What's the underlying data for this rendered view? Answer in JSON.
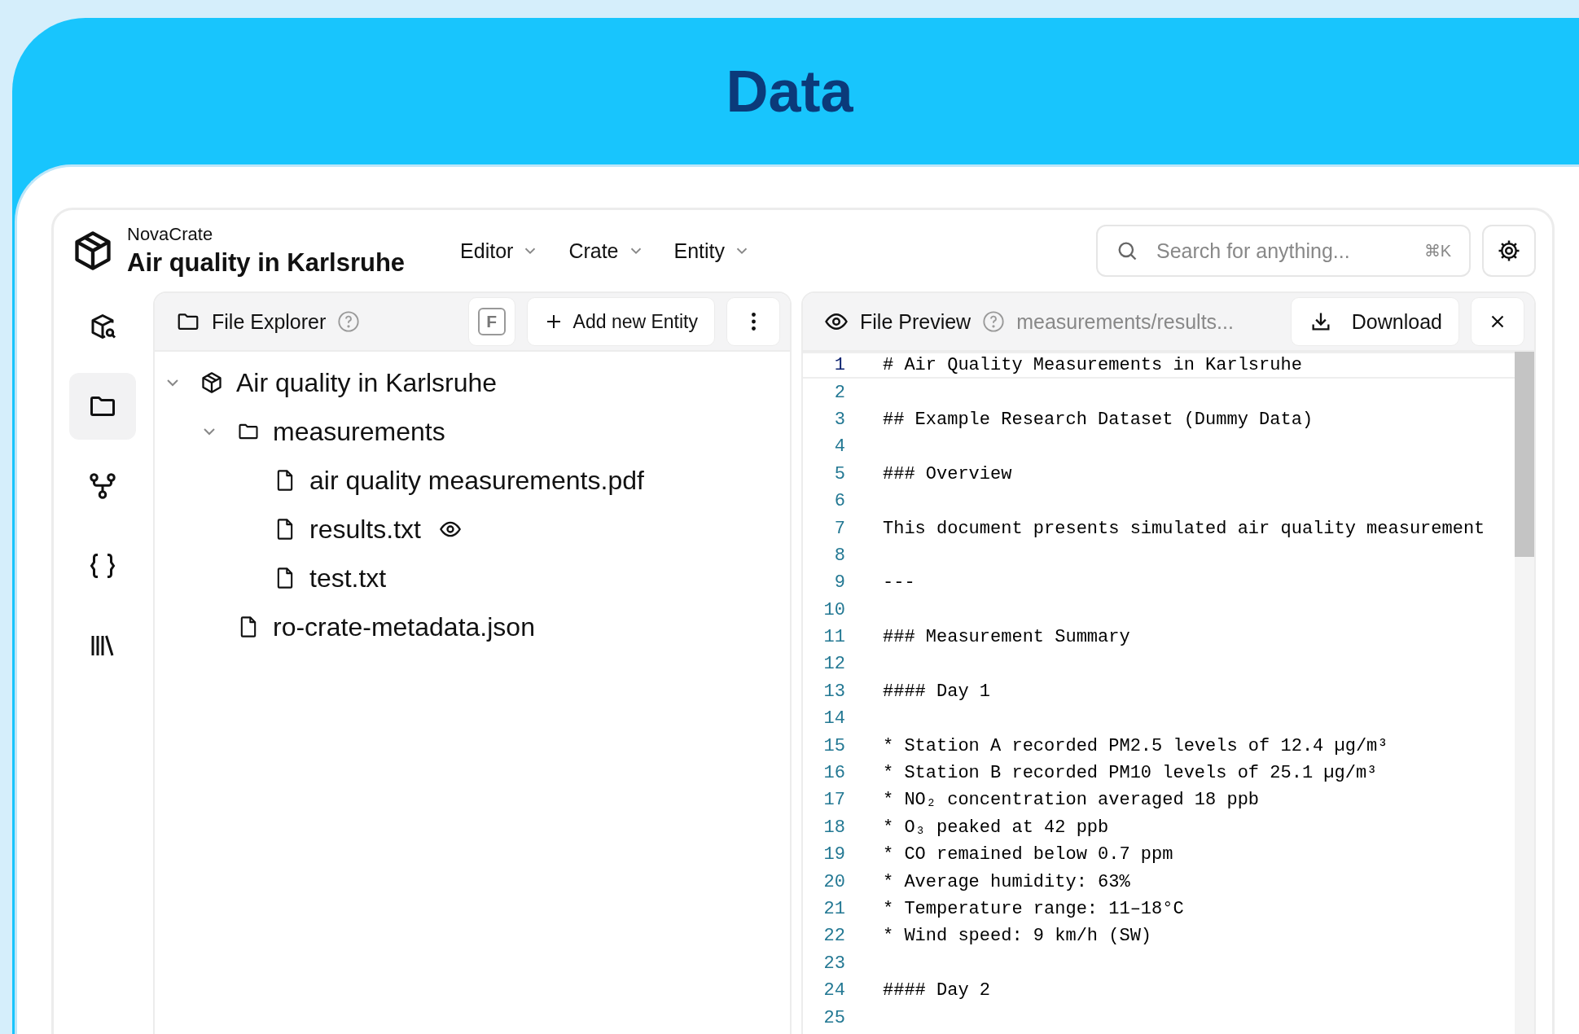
{
  "page_title": "Data",
  "app": {
    "brand": "NovaCrate",
    "project": "Air quality in Karlsruhe"
  },
  "menus": [
    {
      "label": "Editor"
    },
    {
      "label": "Crate"
    },
    {
      "label": "Entity"
    }
  ],
  "search": {
    "placeholder": "Search for anything...",
    "shortcut": "⌘K"
  },
  "sidebar": {
    "items": [
      {
        "kind": "crate-search",
        "selected": false
      },
      {
        "kind": "folder",
        "selected": true
      },
      {
        "kind": "graph",
        "selected": false
      },
      {
        "kind": "json",
        "selected": false
      },
      {
        "kind": "library",
        "selected": false
      }
    ]
  },
  "file_explorer": {
    "title": "File Explorer",
    "shortcut_key": "F",
    "add_button": "Add new Entity",
    "tree": [
      {
        "kind": "crate",
        "name": "Air quality in Karlsruhe",
        "expanded": true,
        "children": [
          {
            "kind": "folder",
            "name": "measurements",
            "expanded": true,
            "children": [
              {
                "kind": "file",
                "name": "air quality measurements.pdf",
                "previewed": false
              },
              {
                "kind": "file",
                "name": "results.txt",
                "previewed": true
              },
              {
                "kind": "file",
                "name": "test.txt",
                "previewed": false
              }
            ]
          },
          {
            "kind": "file",
            "name": "ro-crate-metadata.json",
            "previewed": false
          }
        ]
      }
    ]
  },
  "file_preview": {
    "title": "File Preview",
    "path": "measurements/results...",
    "download_button": "Download",
    "lines": [
      {
        "number": "1",
        "text": "# Air Quality Measurements in Karlsruhe",
        "selected": true
      },
      {
        "number": "2",
        "selected": false
      },
      {
        "number": "3",
        "text": "## Example Research Dataset (Dummy Data)",
        "selected": false
      },
      {
        "number": "4",
        "selected": false
      },
      {
        "number": "5",
        "text": "### Overview",
        "selected": false
      },
      {
        "number": "6",
        "selected": false
      },
      {
        "number": "7",
        "text": "This document presents simulated air quality measurement",
        "selected": false
      },
      {
        "number": "8",
        "selected": false
      },
      {
        "number": "9",
        "text": "---",
        "selected": false
      },
      {
        "number": "10",
        "selected": false
      },
      {
        "number": "11",
        "text": "### Measurement Summary",
        "selected": false
      },
      {
        "number": "12",
        "selected": false
      },
      {
        "number": "13",
        "text": "#### Day 1",
        "selected": false
      },
      {
        "number": "14",
        "selected": false
      },
      {
        "number": "15",
        "text": "* Station A recorded PM2.5 levels of 12.4 µg/m³",
        "selected": false
      },
      {
        "number": "16",
        "text": "* Station B recorded PM10 levels of 25.1 µg/m³",
        "selected": false
      },
      {
        "number": "17",
        "text": "* NO₂ concentration averaged 18 ppb",
        "selected": false
      },
      {
        "number": "18",
        "text": "* O₃ peaked at 42 ppb",
        "selected": false
      },
      {
        "number": "19",
        "text": "* CO remained below 0.7 ppm",
        "selected": false
      },
      {
        "number": "20",
        "text": "* Average humidity: 63%",
        "selected": false
      },
      {
        "number": "21",
        "text": "* Temperature range: 11–18°C",
        "selected": false
      },
      {
        "number": "22",
        "text": "* Wind speed: 9 km/h (SW)",
        "selected": false
      },
      {
        "number": "23",
        "selected": false
      },
      {
        "number": "24",
        "text": "#### Day 2",
        "selected": false
      },
      {
        "number": "25",
        "selected": false
      }
    ]
  }
}
